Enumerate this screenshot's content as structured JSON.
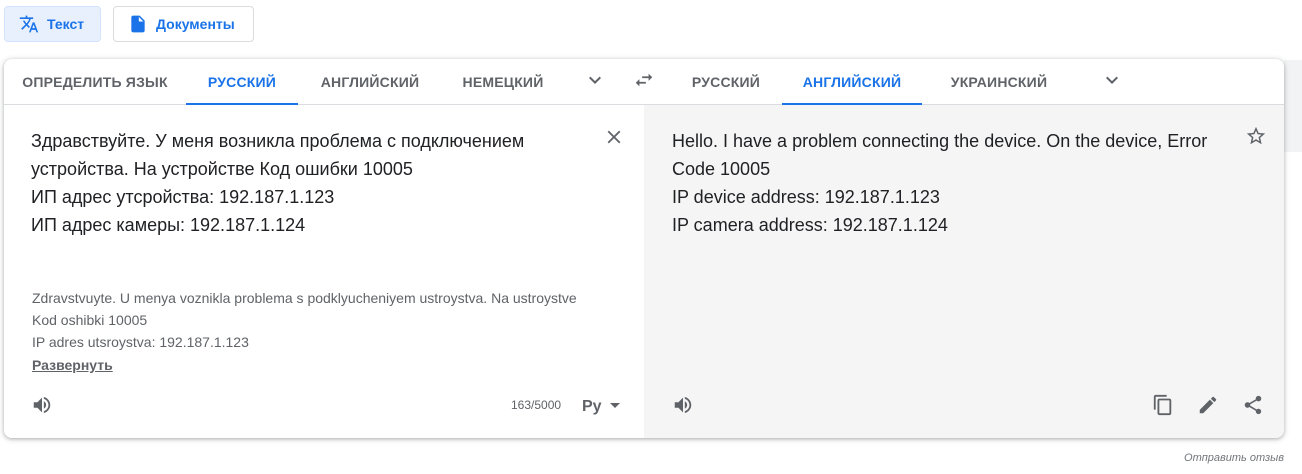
{
  "modes": {
    "text_label": "Текст",
    "docs_label": "Документы"
  },
  "source_langs": {
    "items": [
      "ОПРЕДЕЛИТЬ ЯЗЫК",
      "РУССКИЙ",
      "АНГЛИЙСКИЙ",
      "НЕМЕЦКИЙ"
    ],
    "active_index": 1
  },
  "target_langs": {
    "items": [
      "РУССКИЙ",
      "АНГЛИЙСКИЙ",
      "УКРАИНСКИЙ"
    ],
    "active_index": 1
  },
  "source": {
    "lines": [
      "Здравствуйте. У меня возникла проблема с подключением",
      "устройства. На устройстве Код ошибки 10005",
      "ИП адрес утсройства: 192.187.1.123",
      "ИП адрес камеры: 192.187.1.124"
    ],
    "transliteration": [
      "Zdravstvuyte. U menya voznikla problema s podklyucheniyem ustroystva. Na ustroystve",
      "Kod oshibki 10005",
      "IP adres utsroystva: 192.187.1.123"
    ],
    "expand_label": "Развернуть",
    "counter": "163/5000",
    "keyboard_label": "Py"
  },
  "target": {
    "lines": [
      "Hello. I have a problem connecting the device. On the device, Error",
      "Code 10005",
      "IP device address: 192.187.1.123",
      "IP camera address: 192.187.1.124"
    ]
  },
  "feedback_label": "Отправить отзыв",
  "icons": [
    "translate-icon",
    "document-icon",
    "chevron-down-icon",
    "swap-icon",
    "close-icon",
    "speaker-icon",
    "keyboard-icon",
    "star-icon",
    "copy-icon",
    "pencil-icon",
    "share-icon"
  ],
  "colors": {
    "accent": "#1a73e8",
    "muted_text": "#5f6368",
    "target_bg": "#f5f5f5"
  }
}
